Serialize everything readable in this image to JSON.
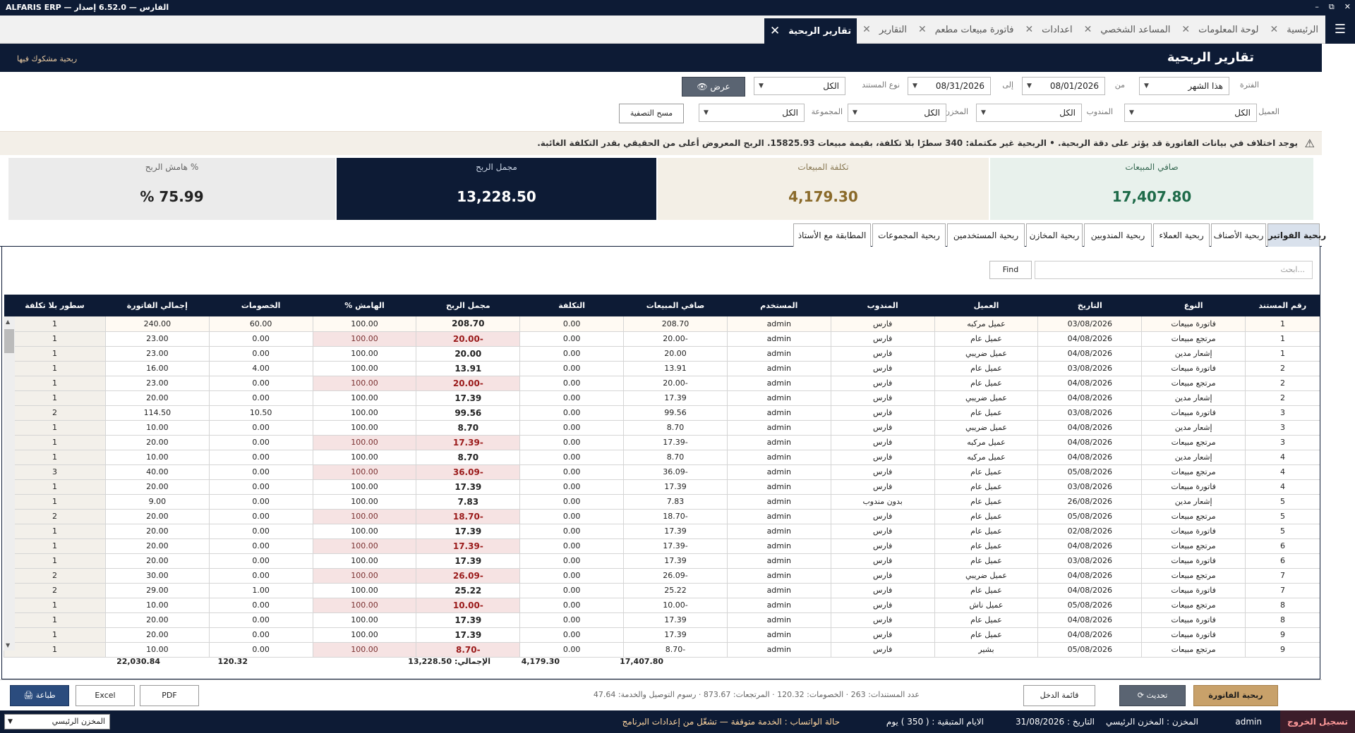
{
  "titlebar": {
    "app_name": "ALFARIS ERP — الفارس — 6.52.0 إصدار",
    "min": "–",
    "restore": "⧉",
    "close": "✕"
  },
  "tabs": [
    {
      "label": "الرئيسية"
    },
    {
      "label": "لوحة المعلومات"
    },
    {
      "label": "المساعد الشخصي"
    },
    {
      "label": "اعدادات"
    },
    {
      "label": "فاتورة مبيعات مطعم"
    },
    {
      "label": "التقارير"
    },
    {
      "label": "تقارير الربحية"
    }
  ],
  "header": {
    "title": "تقارير الربحية",
    "link": "ربحية مشكوك فيها"
  },
  "filters": {
    "period_label": "الفترة",
    "period_value": "هذا الشهر",
    "from_label": "من",
    "from_value": "08/01/2026",
    "to_label": "إلى",
    "to_value": "08/31/2026",
    "doc_type_label": "نوع المستند",
    "doc_type_value": "الكل",
    "view_btn": "عرض",
    "customer_label": "العميل",
    "customer_value": "الكل",
    "rep_label": "المندوب",
    "rep_value": "الكل",
    "store_label": "المخزن",
    "store_value": "الكل",
    "group_label": "المجموعة",
    "group_value": "الكل",
    "clear_btn": "مسح التصفية"
  },
  "warning": {
    "text": "يوجد اختلاف في بيانات الفاتورة قد يؤثر على دقة الربحية. • الربحية غير مكتملة: 340 سطرًا بلا تكلفة، بقيمة مبيعات 15825.93. الربح المعروض أعلى من الحقيقي بقدر التكلفة الغائبة."
  },
  "cards": {
    "net_sales_label": "صافي المبيعات",
    "net_sales_value": "17,407.80",
    "cost_label": "تكلفة المبيعات",
    "cost_value": "4,179.30",
    "gross_label": "مجمل الربح",
    "gross_value": "13,228.50",
    "margin_label": "هامش الربح %",
    "margin_value": "% 75.99",
    "colors": {
      "net": "#1e6b49",
      "cost": "#8a6a2a",
      "gross_bg": "#0d1b35",
      "margin_bg": "#ebebeb"
    }
  },
  "subtabs": [
    "ربحية الفواتير",
    "ربحية الأصناف",
    "ربحية العملاء",
    "ربحية المندوبين",
    "ربحية المخازن",
    "ربحية المستخدمين",
    "ربحية المجموعات",
    "المطابقة مع الأستاذ"
  ],
  "search": {
    "placeholder": "ابحث...",
    "find_btn": "Find"
  },
  "table": {
    "columns": [
      "رقم المستند",
      "النوع",
      "التاريخ",
      "العميل",
      "المندوب",
      "المستخدم",
      "صافي المبيعات",
      "التكلفة",
      "مجمل الربح",
      "الهامش %",
      "الخصومات",
      "إجمالي الفاتورة",
      "سطور بلا تكلفة"
    ],
    "rows": [
      [
        "1",
        "فاتورة مبيعات",
        "03/08/2026",
        "عميل مركبه",
        "فارس",
        "admin",
        "208.70",
        "0.00",
        "208.70",
        "100.00",
        "60.00",
        "240.00",
        "1"
      ],
      [
        "1",
        "مرتجع مبيعات",
        "04/08/2026",
        "عميل عام",
        "فارس",
        "admin",
        "-20.00",
        "0.00",
        "-20.00",
        "100.00",
        "0.00",
        "23.00",
        "1"
      ],
      [
        "1",
        "إشعار مدين",
        "04/08/2026",
        "عميل ضريبي",
        "فارس",
        "admin",
        "20.00",
        "0.00",
        "20.00",
        "100.00",
        "0.00",
        "23.00",
        "1"
      ],
      [
        "2",
        "فاتورة مبيعات",
        "03/08/2026",
        "عميل عام",
        "فارس",
        "admin",
        "13.91",
        "0.00",
        "13.91",
        "100.00",
        "4.00",
        "16.00",
        "1"
      ],
      [
        "2",
        "مرتجع مبيعات",
        "04/08/2026",
        "عميل عام",
        "فارس",
        "admin",
        "-20.00",
        "0.00",
        "-20.00",
        "100.00",
        "0.00",
        "23.00",
        "1"
      ],
      [
        "2",
        "إشعار مدين",
        "04/08/2026",
        "عميل ضريبي",
        "فارس",
        "admin",
        "17.39",
        "0.00",
        "17.39",
        "100.00",
        "0.00",
        "20.00",
        "1"
      ],
      [
        "3",
        "فاتورة مبيعات",
        "03/08/2026",
        "عميل عام",
        "فارس",
        "admin",
        "99.56",
        "0.00",
        "99.56",
        "100.00",
        "10.50",
        "114.50",
        "2"
      ],
      [
        "3",
        "إشعار مدين",
        "04/08/2026",
        "عميل ضريبي",
        "فارس",
        "admin",
        "8.70",
        "0.00",
        "8.70",
        "100.00",
        "0.00",
        "10.00",
        "1"
      ],
      [
        "3",
        "مرتجع مبيعات",
        "04/08/2026",
        "عميل مركبه",
        "فارس",
        "admin",
        "-17.39",
        "0.00",
        "-17.39",
        "100.00",
        "0.00",
        "20.00",
        "1"
      ],
      [
        "4",
        "إشعار مدين",
        "04/08/2026",
        "عميل مركبه",
        "فارس",
        "admin",
        "8.70",
        "0.00",
        "8.70",
        "100.00",
        "0.00",
        "10.00",
        "1"
      ],
      [
        "4",
        "مرتجع مبيعات",
        "05/08/2026",
        "عميل عام",
        "فارس",
        "admin",
        "-36.09",
        "0.00",
        "-36.09",
        "100.00",
        "0.00",
        "40.00",
        "3"
      ],
      [
        "4",
        "فاتورة مبيعات",
        "03/08/2026",
        "عميل عام",
        "فارس",
        "admin",
        "17.39",
        "0.00",
        "17.39",
        "100.00",
        "0.00",
        "20.00",
        "1"
      ],
      [
        "5",
        "إشعار مدين",
        "26/08/2026",
        "عميل عام",
        "بدون مندوب",
        "admin",
        "7.83",
        "0.00",
        "7.83",
        "100.00",
        "0.00",
        "9.00",
        "1"
      ],
      [
        "5",
        "مرتجع مبيعات",
        "05/08/2026",
        "عميل عام",
        "فارس",
        "admin",
        "-18.70",
        "0.00",
        "-18.70",
        "100.00",
        "0.00",
        "20.00",
        "2"
      ],
      [
        "5",
        "فاتورة مبيعات",
        "02/08/2026",
        "عميل عام",
        "فارس",
        "admin",
        "17.39",
        "0.00",
        "17.39",
        "100.00",
        "0.00",
        "20.00",
        "1"
      ],
      [
        "6",
        "مرتجع مبيعات",
        "04/08/2026",
        "عميل عام",
        "فارس",
        "admin",
        "-17.39",
        "0.00",
        "-17.39",
        "100.00",
        "0.00",
        "20.00",
        "1"
      ],
      [
        "6",
        "فاتورة مبيعات",
        "03/08/2026",
        "عميل عام",
        "فارس",
        "admin",
        "17.39",
        "0.00",
        "17.39",
        "100.00",
        "0.00",
        "20.00",
        "1"
      ],
      [
        "7",
        "مرتجع مبيعات",
        "04/08/2026",
        "عميل ضريبي",
        "فارس",
        "admin",
        "-26.09",
        "0.00",
        "-26.09",
        "100.00",
        "0.00",
        "30.00",
        "2"
      ],
      [
        "7",
        "فاتورة مبيعات",
        "04/08/2026",
        "عميل عام",
        "فارس",
        "admin",
        "25.22",
        "0.00",
        "25.22",
        "100.00",
        "1.00",
        "29.00",
        "2"
      ],
      [
        "8",
        "مرتجع مبيعات",
        "05/08/2026",
        "عميل ناش",
        "فارس",
        "admin",
        "-10.00",
        "0.00",
        "-10.00",
        "100.00",
        "0.00",
        "10.00",
        "1"
      ],
      [
        "8",
        "فاتورة مبيعات",
        "04/08/2026",
        "عميل عام",
        "فارس",
        "admin",
        "17.39",
        "0.00",
        "17.39",
        "100.00",
        "0.00",
        "20.00",
        "1"
      ],
      [
        "9",
        "فاتورة مبيعات",
        "04/08/2026",
        "عميل عام",
        "فارس",
        "admin",
        "17.39",
        "0.00",
        "17.39",
        "100.00",
        "0.00",
        "20.00",
        "1"
      ],
      [
        "9",
        "مرتجع مبيعات",
        "05/08/2026",
        "بشير",
        "فارس",
        "admin",
        "-8.70",
        "0.00",
        "-8.70",
        "100.00",
        "0.00",
        "10.00",
        "1"
      ]
    ],
    "totals": {
      "net_sales": "17,407.80",
      "cost": "4,179.30",
      "gross": "الإجمالي: 13,228.50",
      "discounts": "120.32",
      "invoice_total": "22,030.84"
    }
  },
  "footer": {
    "profit_invoice_btn": "ربحية الفاتورة",
    "refresh_btn": "تحديث",
    "income_list_btn": "قائمة الدخل",
    "stats": "عدد المستندات: 263 · الخصومات: 120.32 · المرتجعات: 873.67 · رسوم التوصيل والخدمة: 47.64",
    "pdf_btn": "PDF",
    "excel_btn": "Excel",
    "print_btn": "طباعة"
  },
  "statusbar": {
    "logout": "تسجيل الخروج",
    "user": "admin",
    "store": "المخزن : المخزن الرئيسي",
    "date": "التاريخ : 31/08/2026",
    "days_left": "الايام المتبقية : ( 350 ) يوم",
    "whatsapp": "حالة الواتساب : الخدمة متوقفة — تشغّل من إعدادات البرنامج",
    "warehouse_select": "المخزن الرئيسي"
  }
}
